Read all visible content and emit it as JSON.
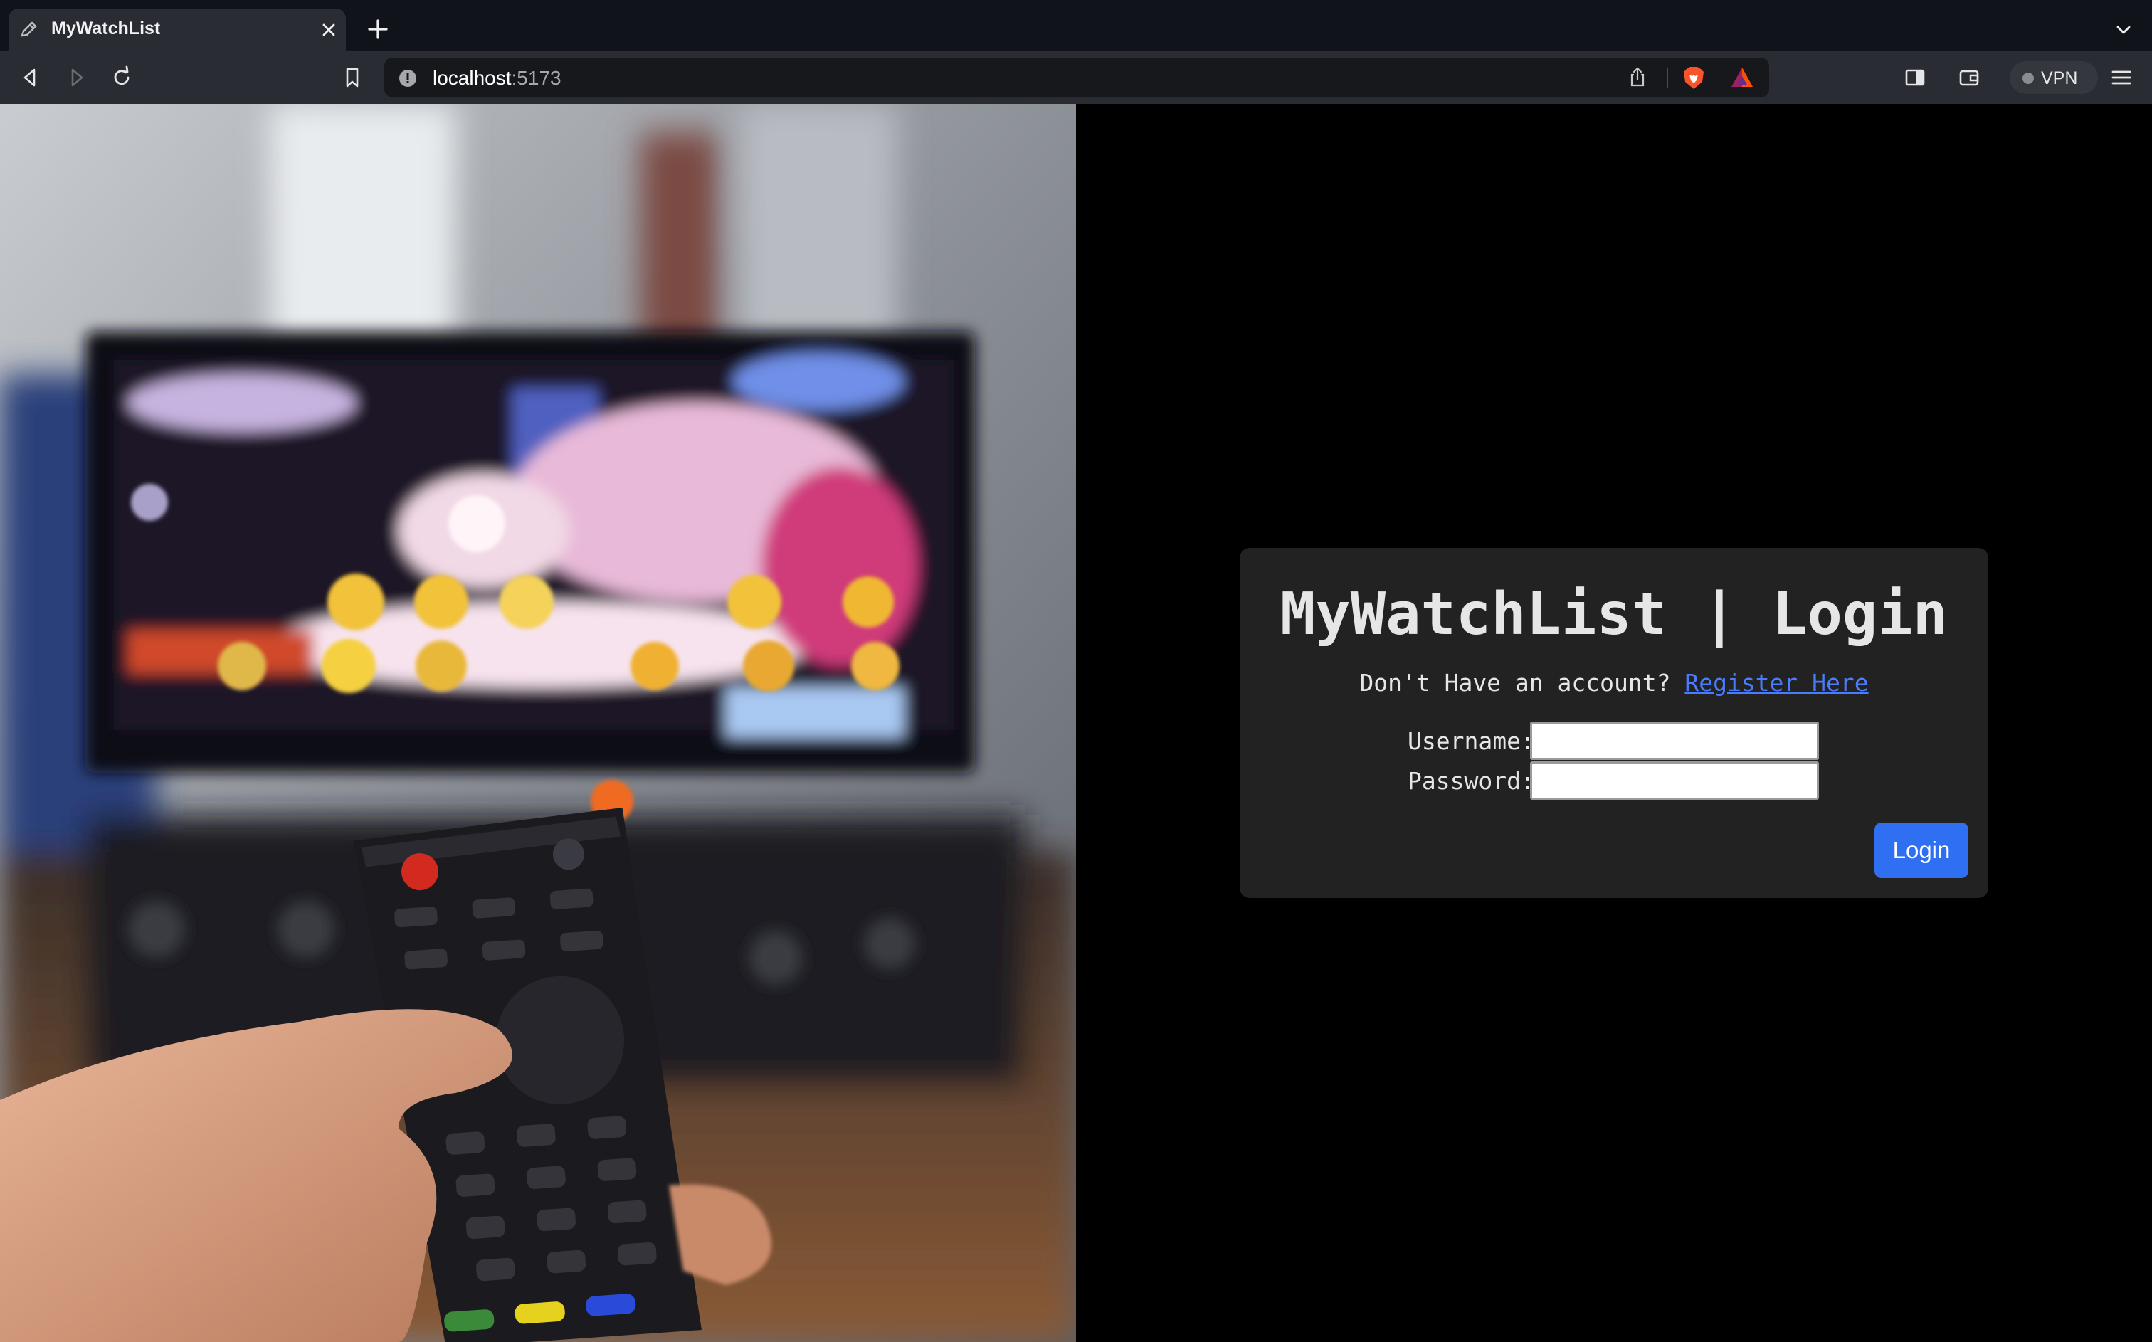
{
  "browser": {
    "tab_title": "MyWatchList",
    "url_host": "localhost",
    "url_port": ":5173",
    "vpn_label": "VPN",
    "icons": [
      "pencil-icon",
      "close-icon",
      "plus-icon",
      "chevron-down-icon",
      "back-icon",
      "forward-icon",
      "reload-icon",
      "bookmark-icon",
      "info-icon",
      "share-icon",
      "brave-lion-icon",
      "bat-triangle-icon",
      "sidebar-icon",
      "wallet-icon",
      "menu-icon"
    ]
  },
  "login": {
    "title": "MyWatchList | Login",
    "prompt": "Don't Have an account?",
    "register_link": "Register Here",
    "username_label": "Username:",
    "password_label": "Password:",
    "username_value": "",
    "password_value": "",
    "submit_label": "Login"
  },
  "colors": {
    "card_bg": "#222222",
    "page_bg": "#000000",
    "accent": "#2f6ff2",
    "link": "#4a7cff"
  }
}
